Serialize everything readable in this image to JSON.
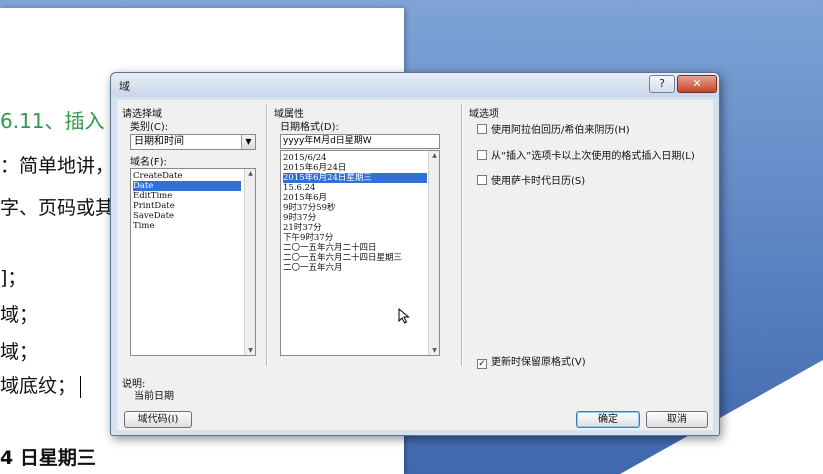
{
  "document": {
    "heading": "6.11、插入",
    "lines": [
      "：简单地讲，",
      "字、页码或其",
      "]；",
      "域；",
      "域；",
      "域底纹；",
      "4 日星期三"
    ]
  },
  "dialog": {
    "title": "域",
    "help_glyph": "?",
    "close_glyph": "✕",
    "choose_field_label": "请选择域",
    "category_label": "类别(C):",
    "category_value": "日期和时间",
    "field_names_label": "域名(F):",
    "field_names": [
      "CreateDate",
      "Date",
      "EditTime",
      "PrintDate",
      "SaveDate",
      "Time"
    ],
    "field_names_selected": 1,
    "field_properties_label": "域属性",
    "date_format_label": "日期格式(D):",
    "date_format_value": "yyyy年M月d日星期W",
    "date_formats": [
      "2015/6/24",
      "2015年6月24日",
      "2015年6月24日星期三",
      "15.6.24",
      "2015年6月",
      "9时37分59秒",
      "9时37分",
      "21时37分",
      "下午9时37分",
      "二〇一五年六月二十四日",
      "二〇一五年六月二十四日星期三",
      "二〇一五年六月"
    ],
    "date_formats_selected": 2,
    "field_options_label": "域选项",
    "options": [
      {
        "label": "使用阿拉伯回历/希伯来阴历(H)",
        "checked": false
      },
      {
        "label": "从“插入”选项卡以上次使用的格式插入日期(L)",
        "checked": false
      },
      {
        "label": "使用萨卡时代日历(S)",
        "checked": false
      }
    ],
    "preserve_formatting": {
      "label": "更新时保留原格式(V)",
      "checked": true
    },
    "description_label": "说明:",
    "description_text": "当前日期",
    "field_codes_button": "域代码(I)",
    "ok_button": "确定",
    "cancel_button": "取消",
    "check_glyph": "✓",
    "dropdown_glyph": "▼",
    "scroll_up_glyph": "▲",
    "scroll_down_glyph": "▼"
  }
}
